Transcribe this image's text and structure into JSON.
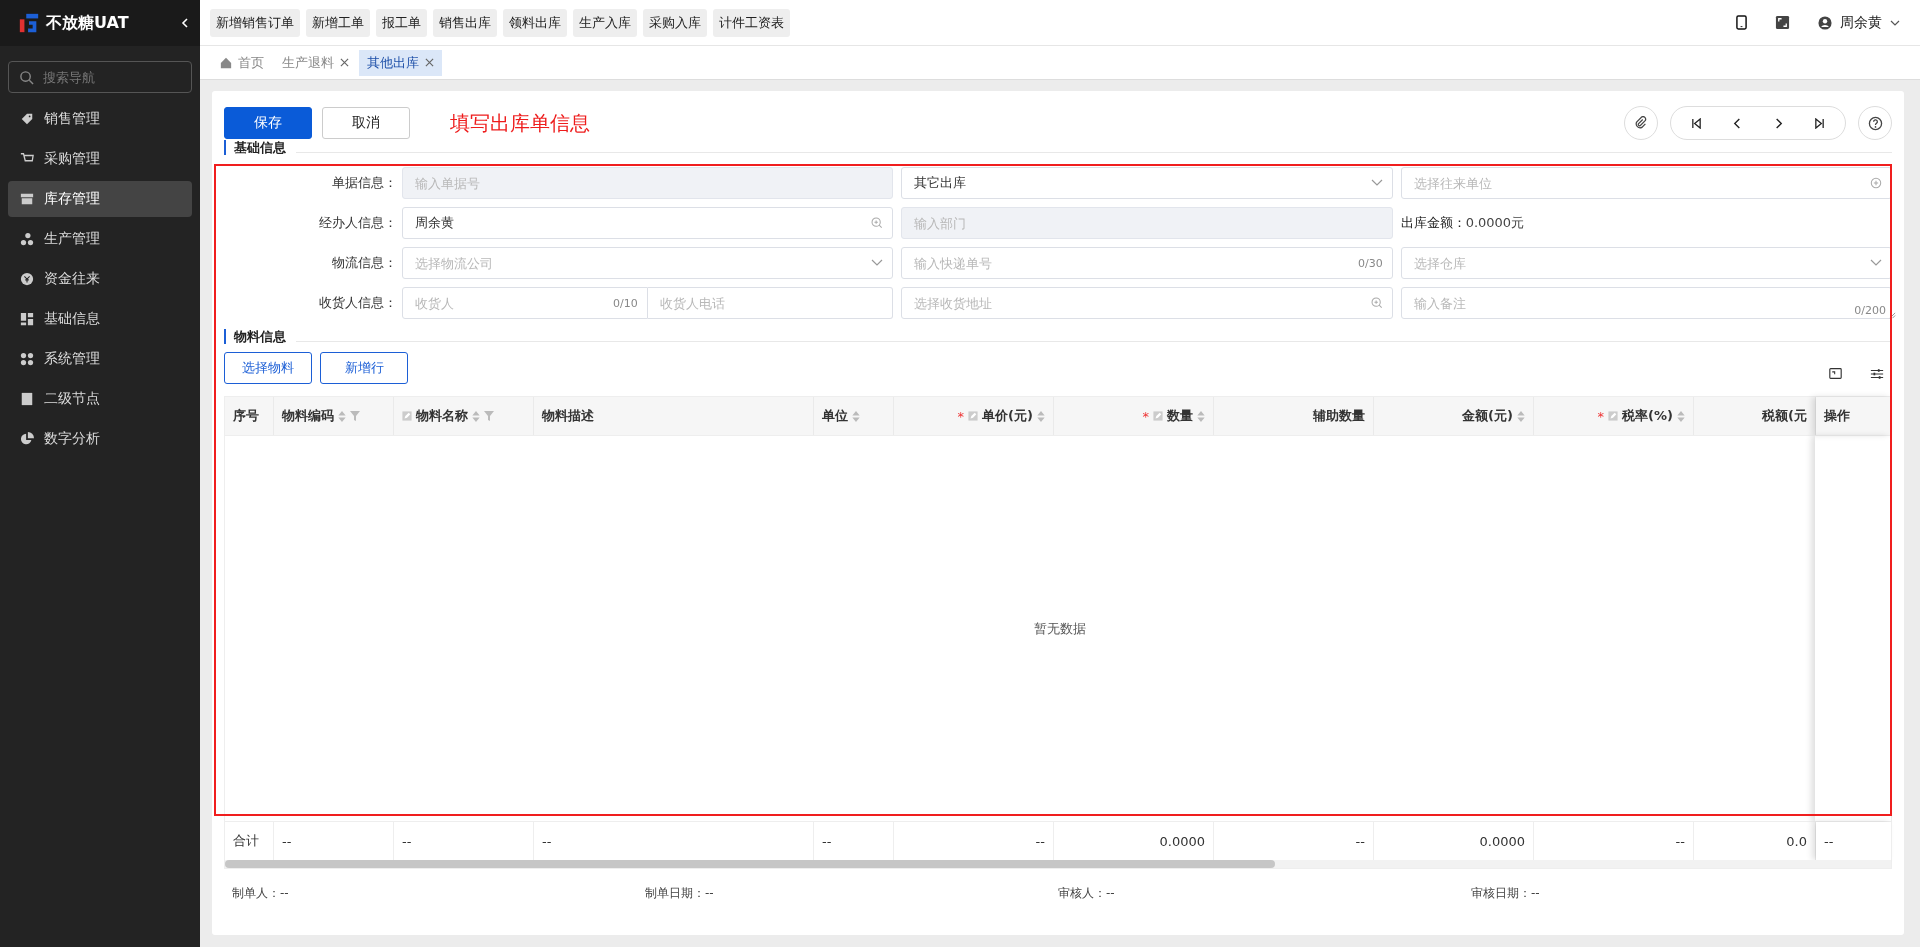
{
  "brand": {
    "name": "不放糖UAT"
  },
  "sidebar": {
    "search": {
      "placeholder": "搜索导航"
    },
    "items": [
      {
        "label": "销售管理",
        "selected": false
      },
      {
        "label": "采购管理",
        "selected": false
      },
      {
        "label": "库存管理",
        "selected": true
      },
      {
        "label": "生产管理",
        "selected": false
      },
      {
        "label": "资金往来",
        "selected": false
      },
      {
        "label": "基础信息",
        "selected": false
      },
      {
        "label": "系统管理",
        "selected": false
      },
      {
        "label": "二级节点",
        "selected": false
      },
      {
        "label": "数字分析",
        "selected": false
      }
    ]
  },
  "quick_links": [
    "新增销售订单",
    "新增工单",
    "报工单",
    "销售出库",
    "领料出库",
    "生产入库",
    "采购入库",
    "计件工资表"
  ],
  "user": {
    "name": "周余黄"
  },
  "tabs": [
    {
      "label": "首页",
      "closable": false,
      "selected": false
    },
    {
      "label": "生产退料",
      "closable": true,
      "selected": false
    },
    {
      "label": "其他出库",
      "closable": true,
      "selected": true
    }
  ],
  "toolbar": {
    "buttons": [
      {
        "label": "保存",
        "primary": true
      },
      {
        "label": "取消",
        "primary": false
      }
    ],
    "note": "填写出库单信息"
  },
  "basic_section": {
    "title": "基础信息",
    "rows": [
      {
        "label": "单据信息：",
        "cells": [
          {
            "kind": "input",
            "placeholder": "输入单据号",
            "disabled": true
          },
          {
            "kind": "select",
            "value": "其它出库",
            "disabled": false
          },
          {
            "kind": "lookup",
            "placeholder": "选择往来单位",
            "disabled": false
          }
        ]
      },
      {
        "label": "经办人信息：",
        "cells": [
          {
            "kind": "search",
            "value": "周余黄",
            "disabled": false
          },
          {
            "kind": "input",
            "placeholder": "输入部门",
            "disabled": true
          },
          {
            "kind": "amount",
            "label": "出库金额：",
            "value": "0.0000元"
          }
        ]
      },
      {
        "label": "物流信息：",
        "cells": [
          {
            "kind": "select",
            "placeholder": "选择物流公司",
            "disabled": false
          },
          {
            "kind": "input",
            "placeholder": "输入快递单号",
            "counter": "0/30",
            "disabled": false
          },
          {
            "kind": "select",
            "placeholder": "选择仓库",
            "disabled": false
          }
        ]
      },
      {
        "label": "收货人信息：",
        "cells": [
          {
            "kind": "pair",
            "first": {
              "placeholder": "收货人",
              "counter": "0/10"
            },
            "second": {
              "placeholder": "收货人电话"
            }
          },
          {
            "kind": "search",
            "placeholder": "选择收货地址",
            "disabled": false
          },
          {
            "kind": "textarea",
            "placeholder": "输入备注",
            "counter": "0/200",
            "disabled": false
          }
        ]
      }
    ]
  },
  "material_section": {
    "title": "物料信息",
    "buttons": [
      "选择物料",
      "新增行"
    ],
    "table": {
      "columns": [
        {
          "label": "序号",
          "editable": false,
          "sortable": false,
          "filterable": false
        },
        {
          "label": "物料编码",
          "editable": false,
          "sortable": true,
          "filterable": true
        },
        {
          "label": "物料名称",
          "editable": true,
          "sortable": true,
          "filterable": true
        },
        {
          "label": "物料描述",
          "editable": false,
          "sortable": false,
          "filterable": false
        },
        {
          "label": "单位",
          "editable": false,
          "sortable": true,
          "filterable": false
        },
        {
          "label": "单价(元)",
          "required_mark": "*",
          "editable": true,
          "sortable": true,
          "filterable": false
        },
        {
          "label": "数量",
          "required_mark": "*",
          "editable": true,
          "sortable": true,
          "filterable": false
        },
        {
          "label": "辅助数量",
          "editable": false,
          "sortable": false,
          "filterable": false
        },
        {
          "label": "金额(元)",
          "editable": false,
          "sortable": true,
          "filterable": false
        },
        {
          "label": "税率(%)",
          "required_mark": "*",
          "editable": true,
          "sortable": true,
          "filterable": false
        },
        {
          "label": "税额(元",
          "editable": false,
          "sortable": false,
          "filterable": false
        },
        {
          "label": "操作",
          "editable": false,
          "sortable": false,
          "filterable": false
        }
      ],
      "empty_text": "暂无数据",
      "totals": [
        "合计",
        "--",
        "--",
        "--",
        "--",
        "--",
        "0.0000",
        "--",
        "0.0000",
        "--",
        "0.0",
        "--"
      ]
    }
  },
  "footer": [
    {
      "label": "制单人：",
      "value": "--"
    },
    {
      "label": "制单日期：",
      "value": "--"
    },
    {
      "label": "审核人：",
      "value": "--"
    },
    {
      "label": "审核日期：",
      "value": "--"
    }
  ]
}
